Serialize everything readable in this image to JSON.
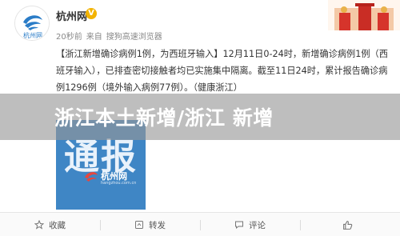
{
  "account": {
    "name": "杭州网",
    "verified_mark": "V",
    "avatar_label": "杭州网"
  },
  "meta": {
    "time": "20秒前",
    "from": "来自",
    "source": "搜狗高速浏览器"
  },
  "post": {
    "text": "【浙江新增确诊病例1例，为西班牙输入】12月11日0-24时，新增确诊病例1例（西班牙输入），已排查密切接触者均已实施集中隔离。截至11日24时，累计报告确诊病例1296例（境外输入病例77例）。（健康浙江）"
  },
  "image": {
    "title": "通报",
    "logo_text": "杭州网",
    "url": "hangzhou.com.cn"
  },
  "overlay": {
    "headline": "浙江本土新增/浙江 新增"
  },
  "actions": [
    {
      "label": "收藏",
      "icon": "star-icon"
    },
    {
      "label": "转发",
      "icon": "repost-icon"
    },
    {
      "label": "评论",
      "icon": "comment-icon"
    },
    {
      "label": "",
      "icon": "like-icon"
    }
  ],
  "colors": {
    "verified": "#f3b300",
    "image_bg": "#3f86c5",
    "overlay": "rgba(150,150,150,0.62)"
  }
}
